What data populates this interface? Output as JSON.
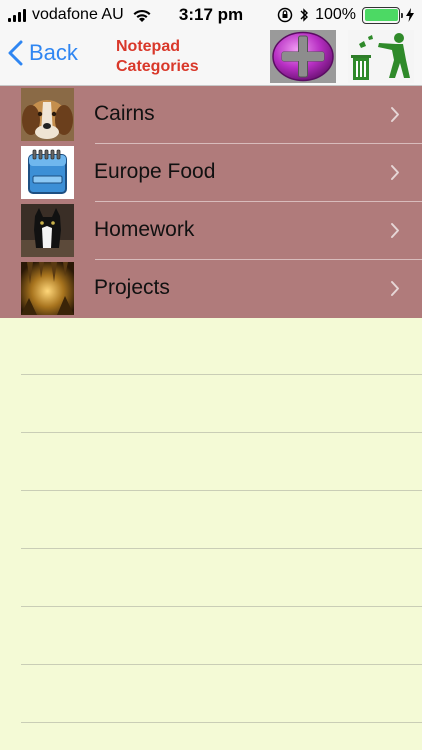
{
  "status_bar": {
    "carrier": "vodafone AU",
    "time": "3:17 pm",
    "battery_percent": "100%",
    "battery_level": 1.0
  },
  "nav": {
    "back_label": "Back",
    "title": "Notepad Categories"
  },
  "categories": [
    {
      "label": "Cairns",
      "thumbnail": "beagle-dog-photo"
    },
    {
      "label": "Europe Food",
      "thumbnail": "notepad-icon"
    },
    {
      "label": "Homework",
      "thumbnail": "black-white-cat-photo"
    },
    {
      "label": "Projects",
      "thumbnail": "golden-cave-photo"
    }
  ],
  "colors": {
    "row_background": "#b07b7b",
    "paper_background": "#f4fad6",
    "title_red": "#d9382a",
    "ios_blue": "#2f86f2",
    "battery_green": "#4cd964"
  }
}
